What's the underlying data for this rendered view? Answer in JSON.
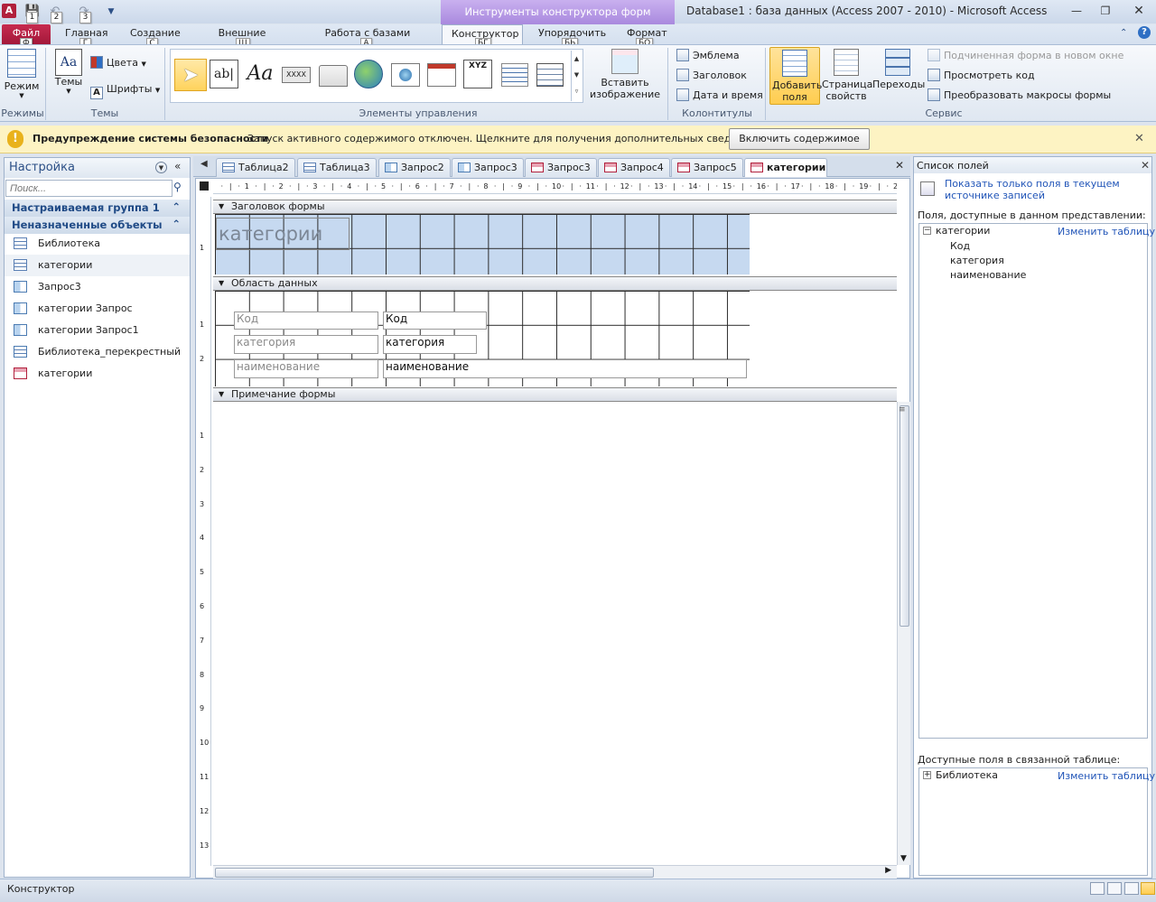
{
  "title_bar": {
    "app_icon_letter": "A",
    "qat_keytips": [
      "1",
      "2",
      "3"
    ],
    "contextual_tools": "Инструменты конструктора форм",
    "window_title": "Database1 : база данных (Access 2007 - 2010)  -  Microsoft Access"
  },
  "ribbon_tabs": [
    {
      "label": "Файл",
      "keytip": "Ф"
    },
    {
      "label": "Главная",
      "keytip": "Г"
    },
    {
      "label": "Создание",
      "keytip": "С"
    },
    {
      "label": "Внешние данные",
      "keytip": "Ш"
    },
    {
      "label": "Работа с базами данных",
      "keytip": "А"
    },
    {
      "label": "Конструктор",
      "keytip": "БГ"
    },
    {
      "label": "Упорядочить",
      "keytip": "БЬ"
    },
    {
      "label": "Формат",
      "keytip": "БО"
    }
  ],
  "ribbon": {
    "mode_label": "Режим",
    "themes_label": "Темы",
    "colors_label": "Цвета",
    "fonts_label": "Шрифты",
    "insert_image_label": "Вставить изображение",
    "logo_label": "Эмблема",
    "title_label": "Заголовок",
    "datetime_label": "Дата и время",
    "add_fields_label": "Добавить поля",
    "property_sheet_label": "Страница свойств",
    "tab_order_label": "Переходы",
    "subform_label": "Подчиненная форма в новом окне",
    "view_code_label": "Просмотреть код",
    "convert_macros_label": "Преобразовать макросы формы",
    "controls_textbox_glyph": "ab|",
    "controls_label_glyph": "Aa",
    "controls_button_glyph": "XXXX",
    "controls_xyz_glyph": "XYZ",
    "groups": {
      "views": "Режимы",
      "themes": "Темы",
      "controls": "Элементы управления",
      "header_footer": "Колонтитулы",
      "tools": "Сервис"
    }
  },
  "security": {
    "title": "Предупреждение системы безопасности",
    "message": "Запуск активного содержимого отключен. Щелкните для получения дополнительных сведений.",
    "button": "Включить содержимое",
    "icon_glyph": "!"
  },
  "nav": {
    "title": "Настройка",
    "search_placeholder": "Поиск...",
    "groups": [
      "Настраиваемая группа 1",
      "Неназначенные объекты"
    ],
    "items": [
      {
        "label": "Библиотека",
        "icon": "table-icon"
      },
      {
        "label": "категории",
        "icon": "table-icon"
      },
      {
        "label": "Запрос3",
        "icon": "query-icon"
      },
      {
        "label": "категории Запрос",
        "icon": "query-icon"
      },
      {
        "label": "категории Запрос1",
        "icon": "query-icon"
      },
      {
        "label": "Библиотека_перекрестный",
        "icon": "crosstab-icon"
      },
      {
        "label": "категории",
        "icon": "form-icon"
      }
    ]
  },
  "doc_tabs": [
    {
      "label": "Таблица2",
      "icon": "table-icon"
    },
    {
      "label": "Таблица3",
      "icon": "table-icon"
    },
    {
      "label": "Запрос2",
      "icon": "query-icon"
    },
    {
      "label": "Запрос3",
      "icon": "query-icon"
    },
    {
      "label": "Запрос3",
      "icon": "form-icon"
    },
    {
      "label": "Запрос4",
      "icon": "form-icon"
    },
    {
      "label": "Запрос5",
      "icon": "form-icon"
    },
    {
      "label": "категории",
      "icon": "form-icon"
    }
  ],
  "design": {
    "ruler_numbers": [
      "1",
      "2",
      "3",
      "4",
      "5",
      "6",
      "7",
      "8",
      "9",
      "10",
      "11",
      "12",
      "13",
      "14",
      "15",
      "16",
      "17",
      "18",
      "19",
      "2"
    ],
    "vruler_header": [
      "1"
    ],
    "vruler_detail": [
      "1",
      "2"
    ],
    "vruler_footer": [
      "1",
      "2",
      "3",
      "4",
      "5",
      "6",
      "7",
      "8",
      "9",
      "10",
      "11",
      "12",
      "13"
    ],
    "sections": {
      "header": "Заголовок формы",
      "detail": "Область данных",
      "footer": "Примечание формы"
    },
    "form_title": "категории",
    "labels": [
      "Код",
      "категория",
      "наименование"
    ],
    "fields": [
      "Код",
      "категория",
      "наименование"
    ]
  },
  "field_list": {
    "title": "Список полей",
    "show_only_link": "Показать только поля в текущем источнике записей",
    "available_label": "Поля, доступные в данном представлении:",
    "table_name": "категории",
    "edit_table_link": "Изменить таблицу",
    "fields": [
      "Код",
      "категория",
      "наименование"
    ],
    "related_label": "Доступные поля в связанной таблице:",
    "related_table": "Библиотека",
    "related_edit_link": "Изменить таблицу"
  },
  "status": {
    "text": "Конструктор"
  }
}
